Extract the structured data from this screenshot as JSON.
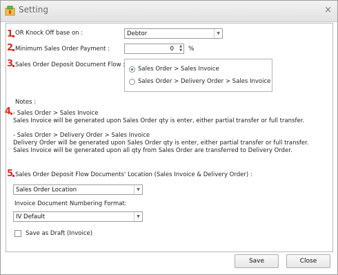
{
  "window": {
    "title": "Setting"
  },
  "markers": [
    "1",
    "2",
    "3",
    "4",
    "5"
  ],
  "or_knock_off": {
    "label": "OR Knock Off base on :",
    "value": "Debtor"
  },
  "min_payment": {
    "label": "Minimum Sales Order Payment :",
    "value": "0",
    "unit": "%"
  },
  "deposit_flow": {
    "label": "Sales Order Deposit Document Flow :",
    "options": [
      {
        "label": "Sales Order > Sales Invoice",
        "selected": true
      },
      {
        "label": "Sales Order > Delivery Order > Sales Invoice",
        "selected": false
      }
    ]
  },
  "notes": {
    "heading": "Notes :",
    "lines": [
      "- Sales Order > Sales Invoice",
      "Sales Invoice will be generated upon Sales Order qty is enter, either partial transfer or full transfer.",
      "- Sales Order > Delivery Order > Sales Invoice",
      "Delivery Order will be generated upon Sales Order qty is enter, either partial transfer or full transfer.",
      "Sales Invoice will be generated upon all qty from Sales Order are transferred to Delivery Order."
    ]
  },
  "location": {
    "label": "Sales Order Deposit Flow Documents' Location (Sales Invoice & Delivery Order) :",
    "value": "Sales Order Location"
  },
  "numbering": {
    "label": "Invoice Document Numbering Format:",
    "value": "IV Default"
  },
  "save_as_draft": {
    "label": "Save as Draft (Invoice)",
    "checked": false
  },
  "buttons": {
    "save": "Save",
    "close": "Close"
  },
  "colors": {
    "marker": "#e2281f",
    "radio_selected": "#1d6fd8"
  }
}
